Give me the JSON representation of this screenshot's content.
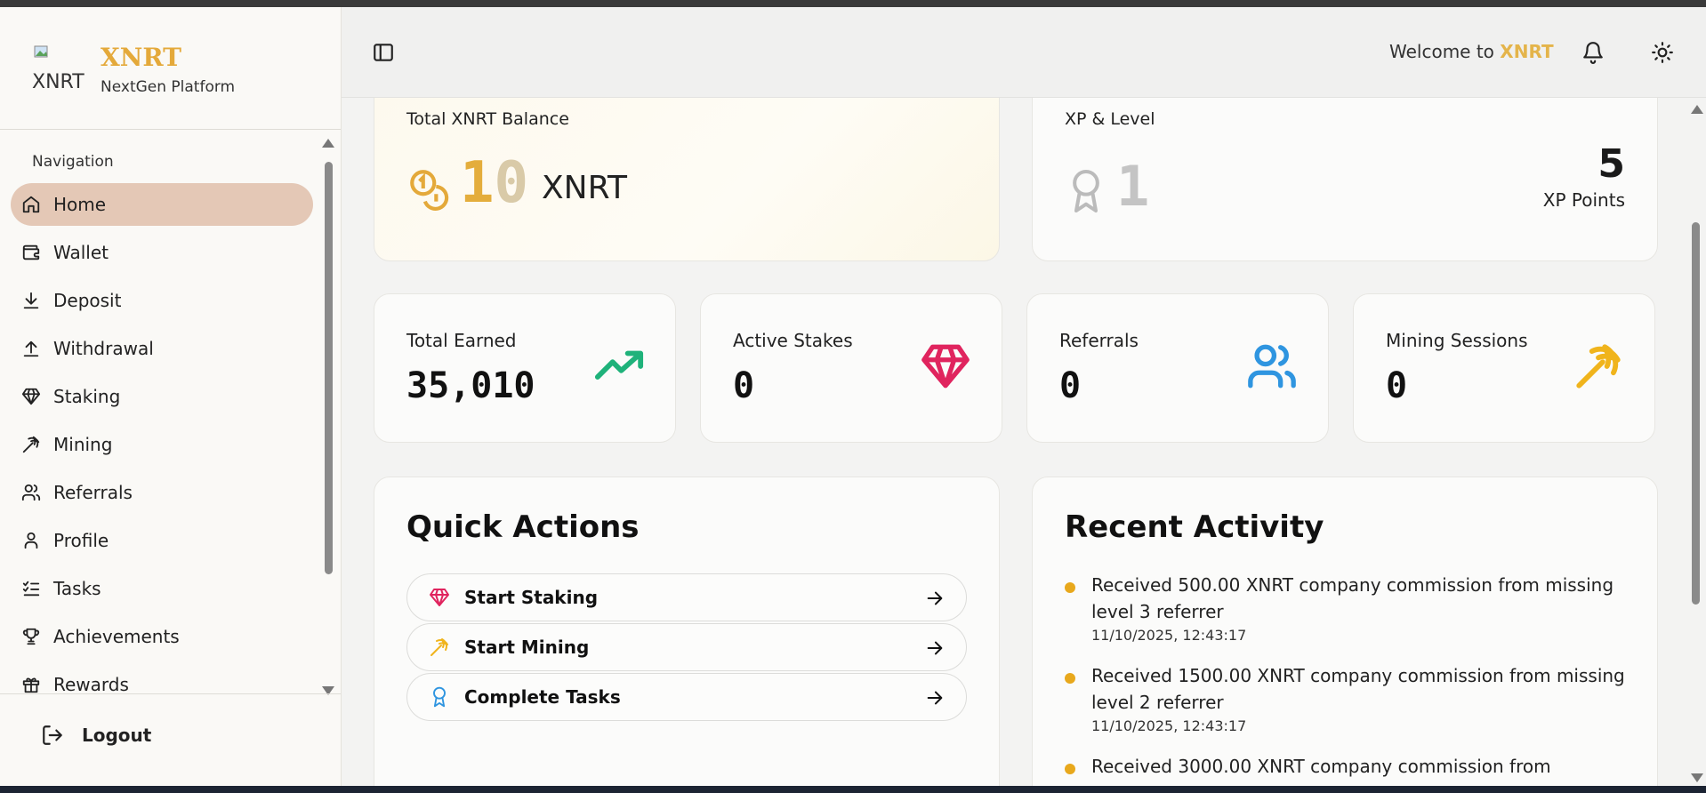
{
  "brand": {
    "logo_alt": "XNRT",
    "name": "XNRT",
    "subtitle": "NextGen Platform"
  },
  "sidebar": {
    "heading": "Navigation",
    "items": [
      {
        "label": "Home",
        "icon": "home-icon",
        "active": true
      },
      {
        "label": "Wallet",
        "icon": "wallet-icon"
      },
      {
        "label": "Deposit",
        "icon": "download-icon"
      },
      {
        "label": "Withdrawal",
        "icon": "upload-icon"
      },
      {
        "label": "Staking",
        "icon": "gem-icon"
      },
      {
        "label": "Mining",
        "icon": "pickaxe-icon"
      },
      {
        "label": "Referrals",
        "icon": "users-icon"
      },
      {
        "label": "Profile",
        "icon": "user-icon"
      },
      {
        "label": "Tasks",
        "icon": "list-checks-icon"
      },
      {
        "label": "Achievements",
        "icon": "trophy-icon"
      },
      {
        "label": "Rewards",
        "icon": "gift-icon"
      }
    ],
    "logout_label": "Logout"
  },
  "topbar": {
    "welcome_prefix": "Welcome to ",
    "welcome_brand": "XNRT"
  },
  "balance": {
    "title": "Total XNRT Balance",
    "amount_main": "1",
    "amount_zero": "0",
    "unit": "XNRT"
  },
  "xp": {
    "title": "XP & Level",
    "level": "1",
    "points": "5",
    "points_label": "XP Points"
  },
  "stats": [
    {
      "label": "Total Earned",
      "value": "35,010",
      "icon": "trending-up-icon",
      "color": "#1fb27a"
    },
    {
      "label": "Active Stakes",
      "value": "0",
      "icon": "gem-icon",
      "color": "#e0245e"
    },
    {
      "label": "Referrals",
      "value": "0",
      "icon": "users-icon",
      "color": "#2f95e0"
    },
    {
      "label": "Mining Sessions",
      "value": "0",
      "icon": "pickaxe-icon",
      "color": "#f0b41c"
    }
  ],
  "quick_actions": {
    "title": "Quick Actions",
    "items": [
      {
        "label": "Start Staking",
        "icon": "gem-icon"
      },
      {
        "label": "Start Mining",
        "icon": "pickaxe-icon"
      },
      {
        "label": "Complete Tasks",
        "icon": "award-icon"
      }
    ]
  },
  "recent_activity": {
    "title": "Recent Activity",
    "items": [
      {
        "text": "Received 500.00 XNRT company commission from missing level 3 referrer",
        "time": "11/10/2025, 12:43:17"
      },
      {
        "text": "Received 1500.00 XNRT company commission from missing level 2 referrer",
        "time": "11/10/2025, 12:43:17"
      },
      {
        "text": "Received 3000.00 XNRT company commission from",
        "time": ""
      }
    ]
  },
  "colors": {
    "accent": "#e4a93a",
    "active_nav": "#e4c8b6"
  }
}
